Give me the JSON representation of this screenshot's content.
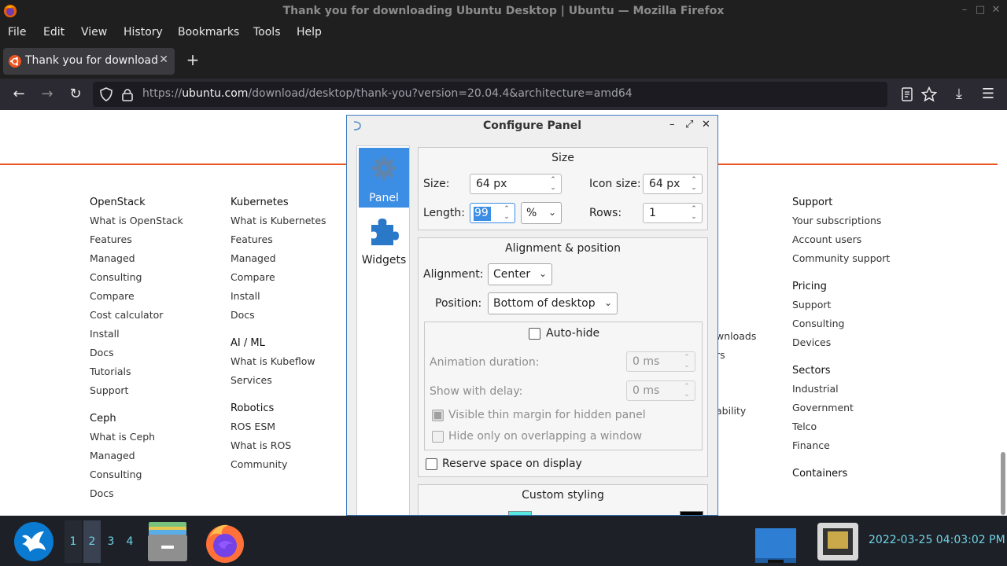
{
  "window": {
    "title": "Thank you for downloading Ubuntu Desktop | Ubuntu — Mozilla Firefox",
    "minimize": "–",
    "maximize": "□",
    "close": "✕"
  },
  "menubar": {
    "items": [
      "File",
      "Edit",
      "View",
      "History",
      "Bookmarks",
      "Tools",
      "Help"
    ]
  },
  "tabs": {
    "active_label": "Thank you for downloading Ubuntu Desktop | Ubuntu",
    "close": "✕",
    "new_tab": "+"
  },
  "nav": {
    "back": "←",
    "forward": "→",
    "reload": "↻",
    "url_prefix": "https://",
    "url_host": "ubuntu.com",
    "url_path": "/download/desktop/thank-you?version=20.04.4&architecture=amd64",
    "download": "⤓",
    "menu": "☰"
  },
  "page": {
    "col1": {
      "heading1": "OpenStack",
      "links1": [
        "What is OpenStack",
        "Features",
        "Managed",
        "Consulting",
        "Compare",
        "Cost calculator",
        "Install",
        "Docs",
        "Tutorials",
        "Support"
      ],
      "heading2": "Ceph",
      "links2": [
        "What is Ceph",
        "Managed",
        "Consulting",
        "Docs"
      ]
    },
    "col2": {
      "heading1": "Kubernetes",
      "links1": [
        "What is Kubernetes",
        "Features",
        "Managed",
        "Compare",
        "Install",
        "Docs"
      ],
      "heading2": "AI / ML",
      "links2": [
        "What is Kubeflow",
        "Services"
      ],
      "heading3": "Robotics",
      "links3": [
        "ROS ESM",
        "What is ROS",
        "Community"
      ]
    },
    "col3_partial": [
      "wnloads",
      "rs",
      "ability"
    ],
    "col4": {
      "heading1": "Support",
      "links1": [
        "Your subscriptions",
        "Account users",
        "Community support"
      ],
      "heading2": "Pricing",
      "links2": [
        "Support",
        "Consulting",
        "Devices"
      ],
      "heading3": "Sectors",
      "links3": [
        "Industrial",
        "Government",
        "Telco",
        "Finance"
      ],
      "heading4": "Containers"
    }
  },
  "dialog": {
    "title": "Configure Panel",
    "controls": {
      "minimize": "–",
      "maximize": "⤢",
      "close": "✕"
    },
    "sidebar": {
      "panel": "Panel",
      "widgets": "Widgets"
    },
    "size": {
      "title": "Size",
      "size_label": "Size:",
      "size_value": "64 px",
      "icon_size_label": "Icon size:",
      "icon_size_value": "64 px",
      "length_label": "Length:",
      "length_value": "99",
      "length_unit": "%",
      "rows_label": "Rows:",
      "rows_value": "1"
    },
    "alignment": {
      "title": "Alignment & position",
      "alignment_label": "Alignment:",
      "alignment_value": "Center",
      "position_label": "Position:",
      "position_value": "Bottom of desktop",
      "autohide_label": "Auto-hide",
      "anim_label": "Animation duration:",
      "anim_value": "0 ms",
      "delay_label": "Show with delay:",
      "delay_value": "0 ms",
      "thin_margin_label": "Visible thin margin for hidden panel",
      "overlap_label": "Hide only on overlapping a window",
      "reserve_label": "Reserve space on display"
    },
    "styling": {
      "title": "Custom styling"
    }
  },
  "taskbar": {
    "workspaces": [
      "1",
      "2",
      "3",
      "4"
    ],
    "clock": "2022-03-25 04:03:02 PM"
  }
}
